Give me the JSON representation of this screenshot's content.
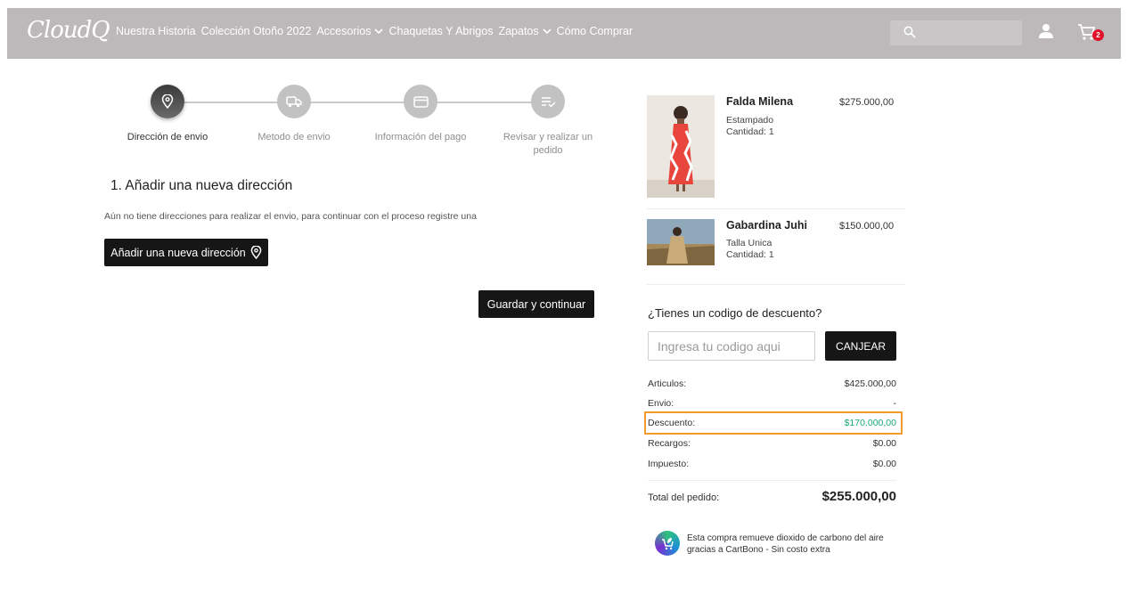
{
  "nav": {
    "logo": "CloudQ",
    "links": [
      "Nuestra Historia",
      "Colección Otoño 2022",
      "Accesorios",
      "Chaquetas Y Abrigos",
      "Zapatos",
      "Cómo Comprar"
    ],
    "cart_count": "2"
  },
  "stepper": {
    "steps": [
      "Dirección de envio",
      "Metodo de envio",
      "Información del pago",
      "Revisar y realizar un pedido"
    ],
    "active_index": 0
  },
  "address": {
    "title": "1. Añadir una nueva dirección",
    "text": "Aún no tiene direcciones para realizar el envio, para continuar con el proceso registre una",
    "add_button": "Añadir una nueva dirección",
    "save_button": "Guardar y continuar"
  },
  "cart": {
    "items": [
      {
        "name": "Falda Milena",
        "variant": "Estampado",
        "quantity": "Cantidad: 1",
        "price": "$275.000,00"
      },
      {
        "name": "Gabardina Juhi",
        "variant": "Talla Unica",
        "quantity": "Cantidad: 1",
        "price": "$150.000,00"
      }
    ]
  },
  "discount": {
    "question": "¿Tienes un codigo de descuento?",
    "placeholder": "Ingresa tu codigo aqui",
    "button": "CANJEAR"
  },
  "summary": {
    "rows": [
      {
        "label": "Articulos:",
        "value": "$425.000,00"
      },
      {
        "label": "Envio:",
        "value": "-"
      },
      {
        "label": "Descuento:",
        "value": "$170.000,00"
      },
      {
        "label": "Recargos:",
        "value": "$0.00"
      },
      {
        "label": "Impuesto:",
        "value": "$0.00"
      }
    ],
    "total_label": "Total del pedido:",
    "total_value": "$255.000,00"
  },
  "cartbono": {
    "text": "Esta compra remueve dioxido de carbono del aire gracias a CartBono - Sin costo extra"
  },
  "colors": {
    "navbar": "#bdb9bb",
    "dark_button": "#161616",
    "discount_green": "#18a67c",
    "highlight_orange": "#f39a2f",
    "badge_red": "#e0132b"
  }
}
